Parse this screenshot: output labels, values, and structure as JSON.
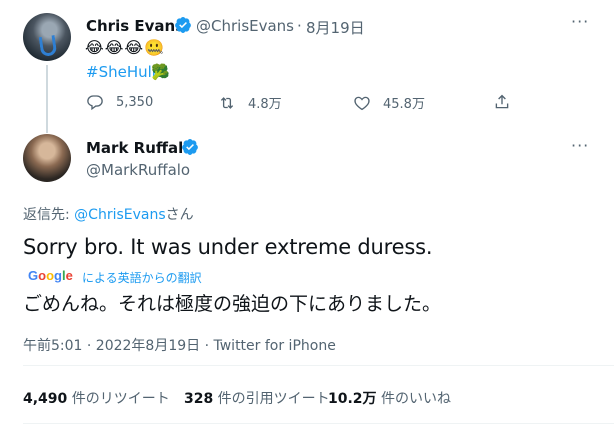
{
  "reply": {
    "name": "Chris Evans",
    "handle": "@ChrisEvans",
    "dot": "·",
    "date": "8月19日",
    "emojis": "😂😂😂🤐",
    "hashtag": "#SheHulk",
    "hashtag_emoji": "🥦",
    "actions": {
      "replies": "5,350",
      "retweets": "4.8万",
      "likes": "45.8万"
    },
    "more": "···"
  },
  "tweet": {
    "name": "Mark Ruffalo",
    "handle": "@MarkRuffalo",
    "more": "···",
    "reply_to_prefix": "返信先: ",
    "reply_to_handle": "@ChrisEvans",
    "reply_to_suffix": "さん",
    "text": "Sorry bro. It was under extreme duress.",
    "translate_label": "による英語からの翻訳",
    "translated_text": "ごめんね。それは極度の強迫の下にありました。",
    "timestamp": "午前5:01 · 2022年8月19日 · Twitter for iPhone"
  },
  "stats": {
    "retweets_count": "4,490",
    "retweets_label": " 件のリツイート",
    "quotes_count": "328",
    "quotes_label": " 件の引用ツイート",
    "likes_count": "10.2万",
    "likes_label": " 件のいいね"
  },
  "colors": {
    "link": "#1d9bf0",
    "muted": "#536471",
    "text": "#0f1419",
    "divider": "#eff3f4"
  },
  "icons": [
    "verified-badge-icon",
    "more-icon",
    "reply-icon",
    "retweet-icon",
    "like-icon",
    "share-icon",
    "google-logo"
  ]
}
